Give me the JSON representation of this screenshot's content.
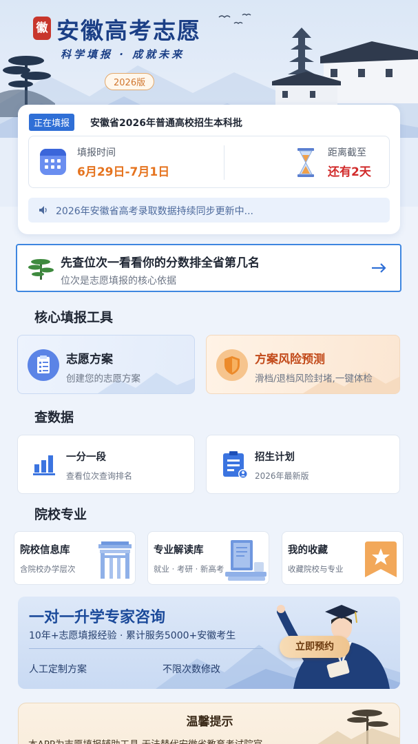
{
  "header": {
    "seal_char": "徽",
    "app_title": "安徽高考志愿",
    "slogan": "科学填报 · 成就未来",
    "version": "2026版"
  },
  "status": {
    "tag": "正在填报",
    "batch": "安徽省2026年普通高校招生本科批",
    "date_label": "填报时间",
    "date_value": "6月29日-7月1日",
    "deadline_label": "距离截至",
    "deadline_value": "还有2天",
    "notice": "2026年安徽省高考录取数据持续同步更新中..."
  },
  "rank_banner": {
    "title": "先查位次一看看你的分数排全省第几名",
    "subtitle": "位次是志愿填报的核心依据"
  },
  "sections": {
    "core_tools": "核心填报工具",
    "query_data": "查数据",
    "college_major": "院校专业"
  },
  "core_tools": [
    {
      "title": "志愿方案",
      "subtitle": "创建您的志愿方案",
      "icon": "clipboard-icon"
    },
    {
      "title": "方案风险预测",
      "subtitle": "滑档/退档风险封堵,一键体检",
      "icon": "shield-icon"
    }
  ],
  "data_tools": [
    {
      "title": "一分一段",
      "subtitle": "查看位次查询排名",
      "icon": "bar-chart-icon"
    },
    {
      "title": "招生计划",
      "subtitle": "2026年最新版",
      "icon": "plan-document-icon"
    }
  ],
  "libraries": [
    {
      "title": "院校信息库",
      "subtitle": "含院校办学层次",
      "icon": "archway-icon"
    },
    {
      "title": "专业解读库",
      "subtitle": "就业 · 考研 · 新高考",
      "icon": "books-icon"
    },
    {
      "title": "我的收藏",
      "subtitle": "收藏院校与专业",
      "icon": "star-bookmark-icon"
    }
  ],
  "consult": {
    "title": "一对一升学专家咨询",
    "subtitle": "10年+志愿填报经验 · 累计服务5000+安徽考生",
    "feature1": "人工定制方案",
    "feature2": "不限次数修改",
    "button": "立即预约"
  },
  "tips": {
    "title": "温馨提示",
    "text": "本APP为志愿填报辅助工具,无法替代安徽省教育考试院官"
  },
  "colors": {
    "brand_blue": "#1b3f86",
    "accent_blue": "#2f6fd6",
    "orange": "#e5731e",
    "red": "#d12b2b",
    "seal_red": "#c8362c"
  }
}
